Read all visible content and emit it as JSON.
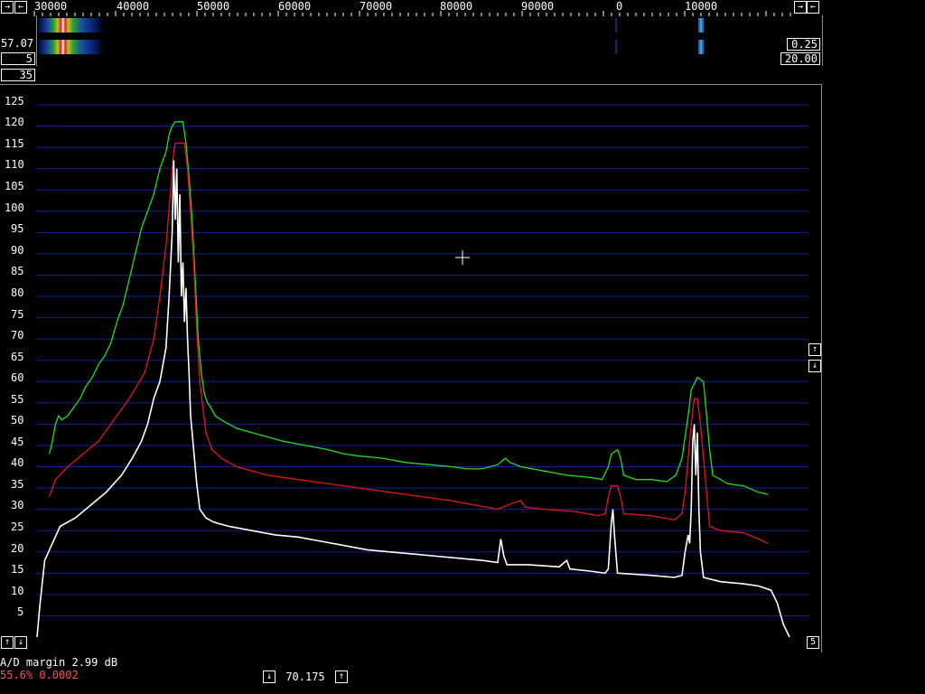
{
  "header": {
    "freq_labels": [
      "30000",
      "40000",
      "50000",
      "60000",
      "70000",
      "80000",
      "90000",
      "0",
      "10000"
    ],
    "left_arrow_label": "→",
    "left_arrow2_label": "←",
    "right_arrow_label": "→",
    "right_arrow2_label": "←"
  },
  "waterfall_controls": {
    "gain_value": "57.07",
    "avg_value": "5",
    "top_value": "35",
    "right_top_value": "0.25",
    "right_bottom_value": "20.00"
  },
  "spectrum": {
    "y_labels": [
      "125",
      "120",
      "115",
      "110",
      "105",
      "100",
      "95",
      "90",
      "85",
      "80",
      "75",
      "70",
      "65",
      "60",
      "55",
      "50",
      "45",
      "40",
      "35",
      "30",
      "25",
      "20",
      "15",
      "10",
      "5"
    ],
    "right_bottom_value": "5",
    "zoom_up_label": "↑",
    "zoom_down_label": "↓",
    "bl_up_label": "↑",
    "bl_down_label": "↓"
  },
  "status": {
    "ad_margin": "A/D margin 2.99 dB",
    "cpu_load": "55.6% 0.0002",
    "freq_down_label": "↓",
    "freq_value": "70.175",
    "freq_up_label": "↑"
  },
  "colors": {
    "grid": "#1020a0",
    "white_trace": "#ffffff",
    "red_trace": "#e01818",
    "green_trace": "#22dd22",
    "cpu_text": "#ff5050"
  },
  "chart_data": {
    "type": "line",
    "ylim": [
      0,
      125
    ],
    "series": [
      {
        "points": [
          [
            0,
            0
          ],
          [
            2,
            8
          ],
          [
            5,
            18
          ],
          [
            10,
            22
          ],
          [
            15,
            26
          ],
          [
            25,
            28
          ],
          [
            35,
            31
          ],
          [
            45,
            34
          ],
          [
            55,
            38
          ],
          [
            62,
            42
          ],
          [
            68,
            46
          ],
          [
            72,
            50
          ],
          [
            76,
            56
          ],
          [
            80,
            60
          ],
          [
            84,
            68
          ],
          [
            86,
            80
          ],
          [
            88,
            95
          ],
          [
            89,
            112
          ],
          [
            90,
            98
          ],
          [
            91,
            110
          ],
          [
            92,
            88
          ],
          [
            93,
            104
          ],
          [
            94,
            80
          ],
          [
            95,
            88
          ],
          [
            96,
            74
          ],
          [
            97,
            82
          ],
          [
            98,
            70
          ],
          [
            99,
            62
          ],
          [
            100,
            52
          ],
          [
            102,
            44
          ],
          [
            104,
            36
          ],
          [
            106,
            30
          ],
          [
            110,
            28
          ],
          [
            115,
            27
          ],
          [
            125,
            26
          ],
          [
            140,
            25
          ],
          [
            155,
            24
          ],
          [
            170,
            23.5
          ],
          [
            185,
            22.5
          ],
          [
            200,
            21.5
          ],
          [
            215,
            20.5
          ],
          [
            230,
            20
          ],
          [
            245,
            19.5
          ],
          [
            260,
            19
          ],
          [
            275,
            18.5
          ],
          [
            290,
            18
          ],
          [
            300,
            17.5
          ],
          [
            302,
            23
          ],
          [
            304,
            19
          ],
          [
            306,
            17
          ],
          [
            320,
            17
          ],
          [
            340,
            16.5
          ],
          [
            345,
            18
          ],
          [
            347,
            16
          ],
          [
            360,
            15.5
          ],
          [
            370,
            15
          ],
          [
            372,
            16
          ],
          [
            374,
            27
          ],
          [
            375,
            30
          ],
          [
            376,
            24
          ],
          [
            378,
            15
          ],
          [
            400,
            14.5
          ],
          [
            415,
            14
          ],
          [
            420,
            14.5
          ],
          [
            422,
            20
          ],
          [
            424,
            24
          ],
          [
            425,
            22
          ],
          [
            426,
            30
          ],
          [
            427,
            46
          ],
          [
            428,
            50
          ],
          [
            429,
            38
          ],
          [
            430,
            48
          ],
          [
            431,
            30
          ],
          [
            432,
            20
          ],
          [
            434,
            14
          ],
          [
            445,
            13
          ],
          [
            460,
            12.5
          ],
          [
            470,
            12
          ],
          [
            478,
            11
          ],
          [
            482,
            8
          ],
          [
            486,
            3
          ],
          [
            490,
            0
          ]
        ],
        "color": "#ffffff"
      },
      {
        "points": [
          [
            8,
            33
          ],
          [
            12,
            37
          ],
          [
            20,
            40
          ],
          [
            30,
            43
          ],
          [
            40,
            46
          ],
          [
            50,
            51
          ],
          [
            60,
            56
          ],
          [
            70,
            62
          ],
          [
            76,
            70
          ],
          [
            80,
            80
          ],
          [
            84,
            92
          ],
          [
            87,
            105
          ],
          [
            89,
            114
          ],
          [
            90,
            116
          ],
          [
            96,
            116
          ],
          [
            98,
            110
          ],
          [
            100,
            100
          ],
          [
            102,
            88
          ],
          [
            104,
            72
          ],
          [
            106,
            60
          ],
          [
            108,
            54
          ],
          [
            110,
            48
          ],
          [
            114,
            44
          ],
          [
            120,
            42
          ],
          [
            130,
            40
          ],
          [
            140,
            39
          ],
          [
            150,
            38
          ],
          [
            170,
            37
          ],
          [
            190,
            36
          ],
          [
            210,
            35
          ],
          [
            230,
            34
          ],
          [
            250,
            33
          ],
          [
            270,
            32
          ],
          [
            285,
            31
          ],
          [
            300,
            30
          ],
          [
            310,
            31.5
          ],
          [
            315,
            32
          ],
          [
            318,
            30.5
          ],
          [
            330,
            30
          ],
          [
            350,
            29.5
          ],
          [
            365,
            28.5
          ],
          [
            370,
            29
          ],
          [
            372,
            33
          ],
          [
            374,
            35.5
          ],
          [
            378,
            35.5
          ],
          [
            380,
            33
          ],
          [
            382,
            29
          ],
          [
            400,
            28.5
          ],
          [
            415,
            27.5
          ],
          [
            420,
            29
          ],
          [
            422,
            34
          ],
          [
            424,
            42
          ],
          [
            426,
            50
          ],
          [
            428,
            56
          ],
          [
            430,
            56
          ],
          [
            432,
            50
          ],
          [
            434,
            42
          ],
          [
            436,
            34
          ],
          [
            438,
            26
          ],
          [
            445,
            25
          ],
          [
            460,
            24.5
          ],
          [
            470,
            23
          ],
          [
            476,
            22
          ]
        ],
        "color": "#e01818"
      },
      {
        "points": [
          [
            8,
            43
          ],
          [
            10,
            46
          ],
          [
            12,
            50
          ],
          [
            14,
            52
          ],
          [
            16,
            51
          ],
          [
            20,
            52
          ],
          [
            24,
            54
          ],
          [
            28,
            56
          ],
          [
            32,
            59
          ],
          [
            36,
            61
          ],
          [
            40,
            64
          ],
          [
            44,
            66
          ],
          [
            48,
            69
          ],
          [
            52,
            74
          ],
          [
            56,
            78
          ],
          [
            60,
            84
          ],
          [
            64,
            90
          ],
          [
            68,
            96
          ],
          [
            72,
            100
          ],
          [
            76,
            104
          ],
          [
            80,
            110
          ],
          [
            84,
            114
          ],
          [
            86,
            118
          ],
          [
            88,
            120
          ],
          [
            90,
            121
          ],
          [
            95,
            121
          ],
          [
            97,
            116
          ],
          [
            99,
            108
          ],
          [
            101,
            98
          ],
          [
            103,
            84
          ],
          [
            105,
            70
          ],
          [
            107,
            62
          ],
          [
            109,
            57
          ],
          [
            111,
            55
          ],
          [
            113,
            54
          ],
          [
            116,
            52
          ],
          [
            120,
            51
          ],
          [
            130,
            49
          ],
          [
            140,
            48
          ],
          [
            150,
            47
          ],
          [
            160,
            46
          ],
          [
            175,
            45
          ],
          [
            190,
            44
          ],
          [
            200,
            43
          ],
          [
            210,
            42.5
          ],
          [
            225,
            42
          ],
          [
            240,
            41
          ],
          [
            255,
            40.5
          ],
          [
            270,
            40
          ],
          [
            280,
            39.5
          ],
          [
            290,
            39.5
          ],
          [
            300,
            40.5
          ],
          [
            305,
            42
          ],
          [
            308,
            41
          ],
          [
            315,
            40
          ],
          [
            330,
            39
          ],
          [
            345,
            38
          ],
          [
            360,
            37.5
          ],
          [
            368,
            37
          ],
          [
            372,
            40
          ],
          [
            374,
            43
          ],
          [
            378,
            44
          ],
          [
            380,
            42
          ],
          [
            382,
            38
          ],
          [
            390,
            37
          ],
          [
            400,
            37
          ],
          [
            410,
            36.5
          ],
          [
            416,
            38
          ],
          [
            420,
            42
          ],
          [
            424,
            52
          ],
          [
            426,
            58
          ],
          [
            430,
            61
          ],
          [
            434,
            60
          ],
          [
            436,
            52
          ],
          [
            438,
            44
          ],
          [
            440,
            38
          ],
          [
            450,
            36
          ],
          [
            460,
            35.5
          ],
          [
            470,
            34
          ],
          [
            476,
            33.5
          ]
        ],
        "color": "#22dd22"
      }
    ]
  }
}
